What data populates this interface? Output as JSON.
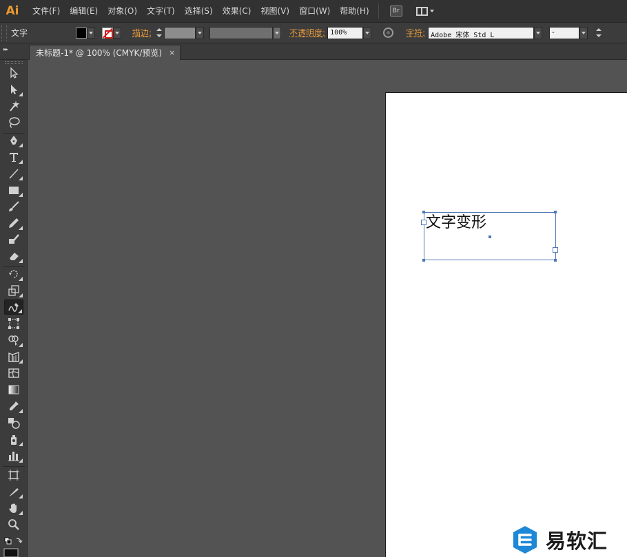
{
  "app": {
    "logo": "Ai"
  },
  "menu": [
    "文件(F)",
    "编辑(E)",
    "对象(O)",
    "文字(T)",
    "选择(S)",
    "效果(C)",
    "视图(V)",
    "窗口(W)",
    "帮助(H)"
  ],
  "menubar_buttons": {
    "bridge": "Br",
    "workspace_icon": "workspace-layout-icon"
  },
  "control_bar": {
    "tool_label": "文字",
    "fill_color": "#000000",
    "stroke_color": "none",
    "stroke_label": "描边:",
    "opacity_label": "不透明度:",
    "opacity_value": "100%",
    "character_label": "字符:",
    "font_family": "Adobe 宋体 Std L",
    "font_style": "-"
  },
  "document_tab": {
    "title": "未标题-1* @ 100% (CMYK/预览)",
    "close": "×"
  },
  "toolbox": {
    "tools": [
      "selection-tool-icon",
      "direct-selection-tool-icon",
      "magic-wand-tool-icon",
      "lasso-tool-icon",
      "pen-tool-icon",
      "type-tool-icon",
      "line-segment-tool-icon",
      "rectangle-tool-icon",
      "paintbrush-tool-icon",
      "pencil-tool-icon",
      "blob-brush-tool-icon",
      "eraser-tool-icon",
      "rotate-tool-icon",
      "scale-tool-icon",
      "warp-tool-icon",
      "free-transform-tool-icon",
      "shape-builder-tool-icon",
      "perspective-grid-tool-icon",
      "mesh-tool-icon",
      "gradient-tool-icon",
      "eyedropper-tool-icon",
      "blend-tool-icon",
      "symbol-sprayer-tool-icon",
      "column-graph-tool-icon",
      "artboard-tool-icon",
      "slice-tool-icon",
      "hand-tool-icon",
      "zoom-tool-icon"
    ],
    "active_tool": "warp-tool-icon"
  },
  "artboard": {
    "text": "文字变形"
  },
  "watermark": {
    "text": "易软汇"
  },
  "colors": {
    "accent_orange": "#e89a3c",
    "selection_blue": "#4e78b7",
    "logo_orange": "#ec9a2b",
    "watermark_blue": "#1e88d8"
  }
}
